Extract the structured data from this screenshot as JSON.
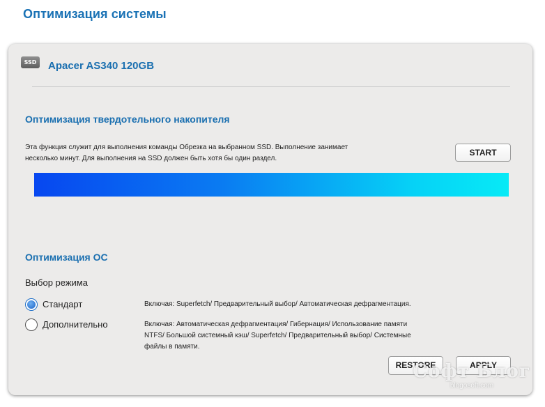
{
  "page": {
    "title": "Оптимизация системы"
  },
  "drive": {
    "icon": "ssd-icon",
    "icon_text": "SSD",
    "name": "Apacer AS340 120GB"
  },
  "ssd_section": {
    "title": "Оптимизация твердотельного накопителя",
    "description_line1": "Эта функция служит для выполнения команды Обрезка на выбранном SSD. Выполнение занимает",
    "description_line2": "несколько минут. Для выполнения на SSD должен быть хотя бы один раздел.",
    "start_label": "START",
    "progress_percent": 100
  },
  "os_section": {
    "title": "Оптимизация ОС",
    "mode_label": "Выбор режима",
    "options": [
      {
        "label": "Стандарт",
        "selected": true,
        "desc_line1": "Включая: Superfetch/ Предварительный выбор/ Автоматическая дефрагментация."
      },
      {
        "label": "Дополнительно",
        "selected": false,
        "desc_line1": "Включая: Автоматическая дефрагментация/ Гибернация/ Использование памяти",
        "desc_line2": "NTFS/ Большой системный кэш/ Superfetch/ Предварительный выбор/ Системные",
        "desc_line3": "файлы в памяти."
      }
    ],
    "restore_label": "RESTORE",
    "apply_label": "APPLY"
  },
  "watermark": {
    "main": "Софт Блог",
    "sub": "blogosoft.com"
  },
  "colors": {
    "accent": "#1a6fb0",
    "panel_bg": "#ecebea",
    "progress_start": "#0747f0",
    "progress_end": "#07eaf6"
  }
}
